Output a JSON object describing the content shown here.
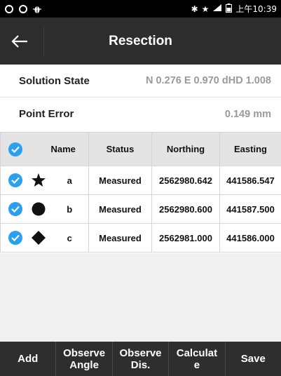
{
  "status_bar": {
    "left_icons": [
      "sync-icon",
      "sync-icon",
      "bug-icon"
    ],
    "right_icons": [
      "bluetooth-icon",
      "star-icon",
      "signal-4g-icon",
      "battery-icon"
    ],
    "time": "上午10:39"
  },
  "app_bar": {
    "title": "Resection",
    "back_icon": "arrow-left-icon"
  },
  "solution_state": {
    "label": "Solution State",
    "value": "N 0.276 E 0.970 dHD 1.008"
  },
  "point_error": {
    "label": "Point Error",
    "value": "0.149 mm"
  },
  "table": {
    "headers": {
      "name": "Name",
      "status": "Status",
      "northing": "Northing",
      "easting": "Easting"
    },
    "rows": [
      {
        "checked": true,
        "shape": "star",
        "name": "a",
        "status": "Measured",
        "northing": "2562980.642",
        "easting": "441586.547"
      },
      {
        "checked": true,
        "shape": "circle",
        "name": "b",
        "status": "Measured",
        "northing": "2562980.600",
        "easting": "441587.500"
      },
      {
        "checked": true,
        "shape": "diamond",
        "name": "c",
        "status": "Measured",
        "northing": "2562981.000",
        "easting": "441586.000"
      }
    ]
  },
  "bottom_bar": {
    "add": "Add",
    "observe_angle": "Observe\nAngle",
    "observe_dis": "Observe\nDis.",
    "calculate": "Calculat\ne",
    "save": "Save"
  },
  "colors": {
    "accent": "#2aa0f0",
    "app_bar": "#2d2d2d",
    "header_bg": "#e4e4e4"
  }
}
